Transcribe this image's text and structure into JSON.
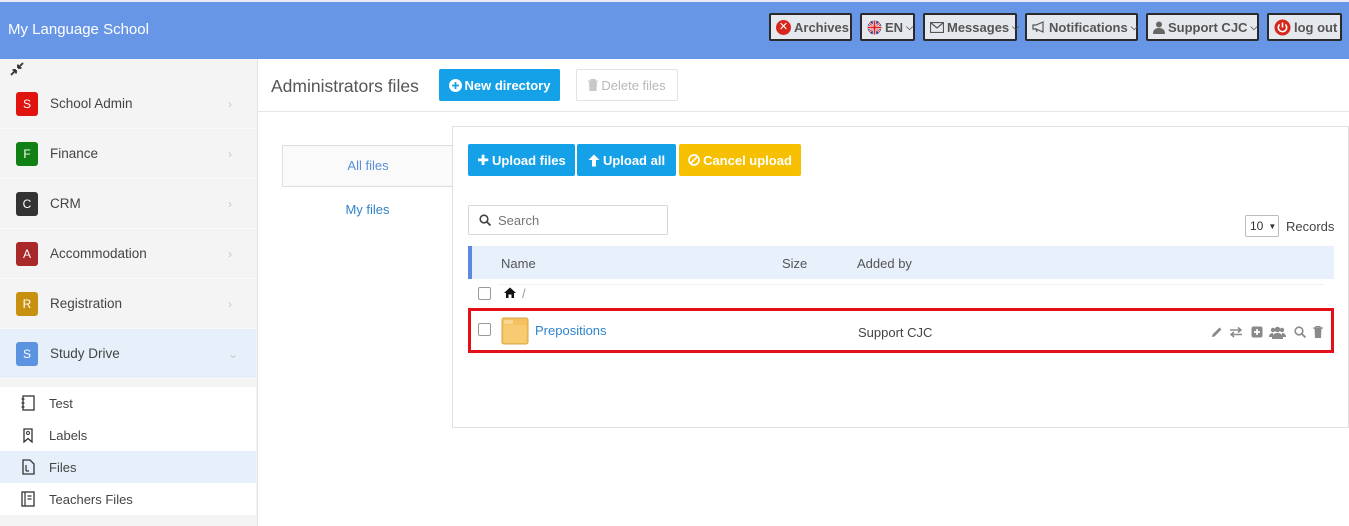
{
  "topbar": {
    "app_title": "My Language School",
    "archives": "Archives",
    "language": "EN",
    "messages": "Messages",
    "notifications": "Notifications",
    "user": "Support CJC",
    "logout": "log out",
    "colors": {
      "bar": "#6896e6",
      "button": "#e5e8ec"
    }
  },
  "sidebar": {
    "modules": [
      {
        "letter": "S",
        "label": "School Admin",
        "color": "#e0130f"
      },
      {
        "letter": "F",
        "label": "Finance",
        "color": "#107f14"
      },
      {
        "letter": "C",
        "label": "CRM",
        "color": "#333333"
      },
      {
        "letter": "A",
        "label": "Accommodation",
        "color": "#a9282a"
      },
      {
        "letter": "R",
        "label": "Registration",
        "color": "#c7910f"
      },
      {
        "letter": "S",
        "label": "Study Drive",
        "color": "#5b93e1"
      }
    ],
    "sub_items": [
      {
        "label": "Test",
        "icon": "notebook-icon"
      },
      {
        "label": "Labels",
        "icon": "bookmark-icon"
      },
      {
        "label": "Files",
        "icon": "file-icon"
      },
      {
        "label": "Teachers Files",
        "icon": "book-icon"
      }
    ]
  },
  "main": {
    "title": "Administrators files",
    "new_directory": "New directory",
    "delete_files": "Delete files",
    "tabs": {
      "all": "All files",
      "mine": "My files"
    },
    "upload_files": "Upload files",
    "upload_all": "Upload all",
    "cancel_upload": "Cancel upload",
    "search_placeholder": "Search",
    "records_value": "10",
    "records_label": "Records",
    "columns": {
      "name": "Name",
      "size": "Size",
      "added_by": "Added by"
    },
    "root_path": "/",
    "rows": [
      {
        "name": "Prepositions",
        "size": "",
        "added_by": "Support CJC"
      }
    ],
    "row_actions": [
      "pencil-icon",
      "move-icon",
      "add-icon",
      "users-icon",
      "search-icon",
      "trash-icon"
    ]
  }
}
